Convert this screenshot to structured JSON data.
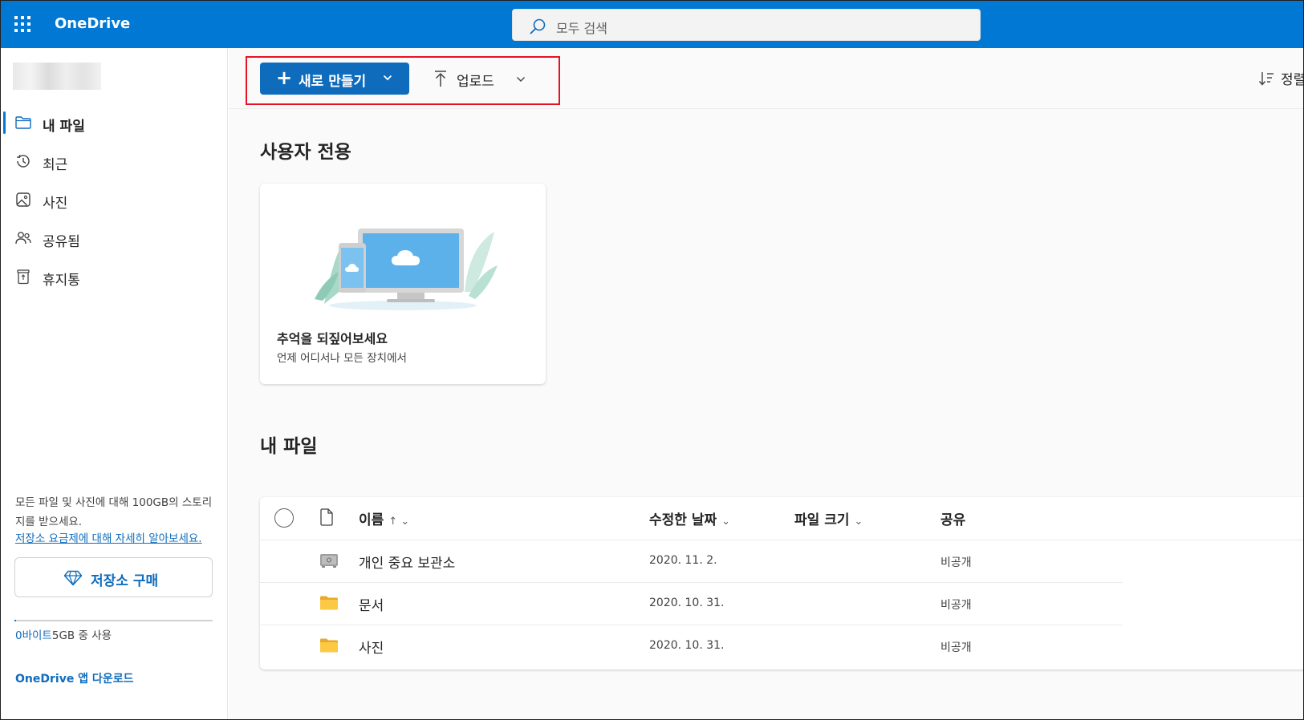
{
  "header": {
    "app_name": "OneDrive",
    "search_placeholder": "모두 검색",
    "accent_color": "#0078d4"
  },
  "sidebar": {
    "items": [
      {
        "label": "내 파일",
        "icon": "folder-icon",
        "active": true
      },
      {
        "label": "최근",
        "icon": "history-icon",
        "active": false
      },
      {
        "label": "사진",
        "icon": "photo-icon",
        "active": false
      },
      {
        "label": "공유됨",
        "icon": "people-icon",
        "active": false
      },
      {
        "label": "휴지통",
        "icon": "recycle-bin-icon",
        "active": false
      }
    ],
    "storage_promo": "모든 파일 및 사진에 대해 100GB의 스토리지를 받으세요.",
    "storage_link": "저장소 요금제에 대해 자세히 알아보세요.",
    "buy_storage_label": "저장소 구매",
    "usage_used": "0바이트",
    "usage_rest": "5GB 중 사용",
    "usage_fraction": 0,
    "app_download": "OneDrive 앱 다운로드"
  },
  "toolbar": {
    "new_label": "새로 만들기",
    "upload_label": "업로드",
    "sort_label": "정렬"
  },
  "for_you": {
    "title": "사용자 전용",
    "card_title": "추억을 되짚어보세요",
    "card_subtitle": "언제 어디서나 모든 장치에서"
  },
  "my_files": {
    "title": "내 파일",
    "columns": {
      "name": "이름",
      "modified": "수정한 날짜",
      "size": "파일 크기",
      "sharing": "공유"
    },
    "rows": [
      {
        "name": "개인 중요 보관소",
        "icon": "vault-icon",
        "modified": "2020. 11. 2.",
        "size": "",
        "sharing": "비공개"
      },
      {
        "name": "문서",
        "icon": "folder-icon",
        "modified": "2020. 10. 31.",
        "size": "",
        "sharing": "비공개"
      },
      {
        "name": "사진",
        "icon": "folder-icon",
        "modified": "2020. 10. 31.",
        "size": "",
        "sharing": "비공개"
      }
    ]
  }
}
